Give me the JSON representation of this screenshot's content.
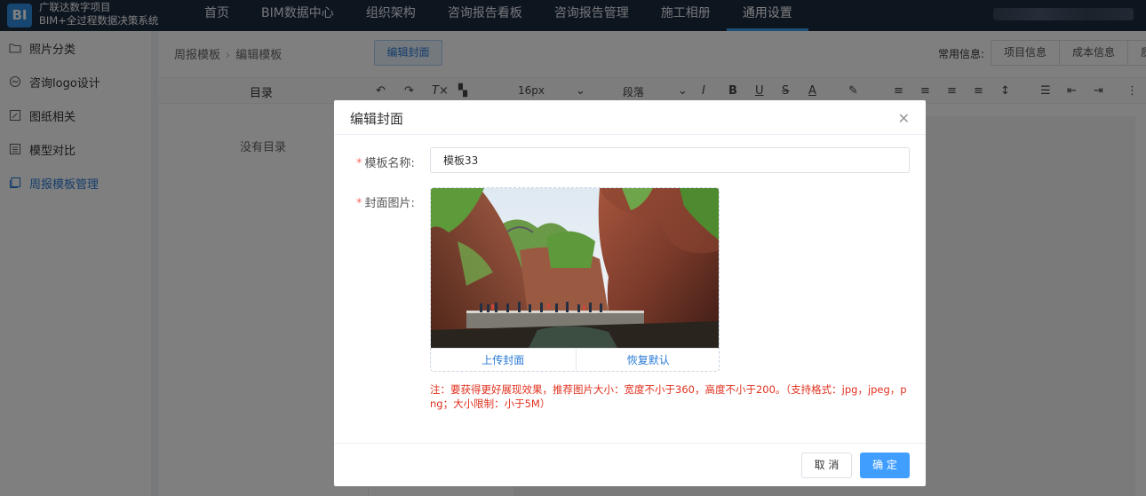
{
  "app": {
    "logo_text": "BI",
    "brand_line1": "广联达数字项目",
    "brand_line2": "BIM+全过程数据决策系统"
  },
  "nav": {
    "items": [
      {
        "label": "首页"
      },
      {
        "label": "BIM数据中心"
      },
      {
        "label": "组织架构"
      },
      {
        "label": "咨询报告看板"
      },
      {
        "label": "咨询报告管理"
      },
      {
        "label": "施工相册"
      },
      {
        "label": "通用设置",
        "active": true
      }
    ]
  },
  "sidebar": {
    "items": [
      {
        "label": "照片分类",
        "icon": "folder-icon"
      },
      {
        "label": "咨询logo设计",
        "icon": "palette-icon"
      },
      {
        "label": "图纸相关",
        "icon": "edit-icon"
      },
      {
        "label": "模型对比",
        "icon": "compare-icon"
      },
      {
        "label": "周报模板管理",
        "icon": "template-icon",
        "active": true
      }
    ]
  },
  "main": {
    "breadcrumb": [
      "周报模板",
      "编辑模板"
    ],
    "tab_label": "编辑封面",
    "common_info_label": "常用信息:",
    "common_tabs": [
      "项目信息",
      "成本信息",
      "质"
    ],
    "toc_title": "目录",
    "toc_empty": "没有目录",
    "font_size": "16px",
    "paragraph": "段落"
  },
  "dialog": {
    "title": "编辑封面",
    "name_label": "模板名称:",
    "name_value": "模板33",
    "cover_label": "封面图片:",
    "upload_label": "上传封面",
    "reset_label": "恢复默认",
    "note": "注：要获得更好展现效果，推荐图片大小：宽度不小于360，高度不小于200。（支持格式：jpg，jpeg，png；大小限制：小于5M）",
    "cancel_label": "取 消",
    "ok_label": "确 定"
  },
  "colors": {
    "topbar_bg": "#1b2a3f",
    "accent": "#409eff",
    "warning_text": "#e0301e",
    "required_star": "#f56c6c"
  }
}
